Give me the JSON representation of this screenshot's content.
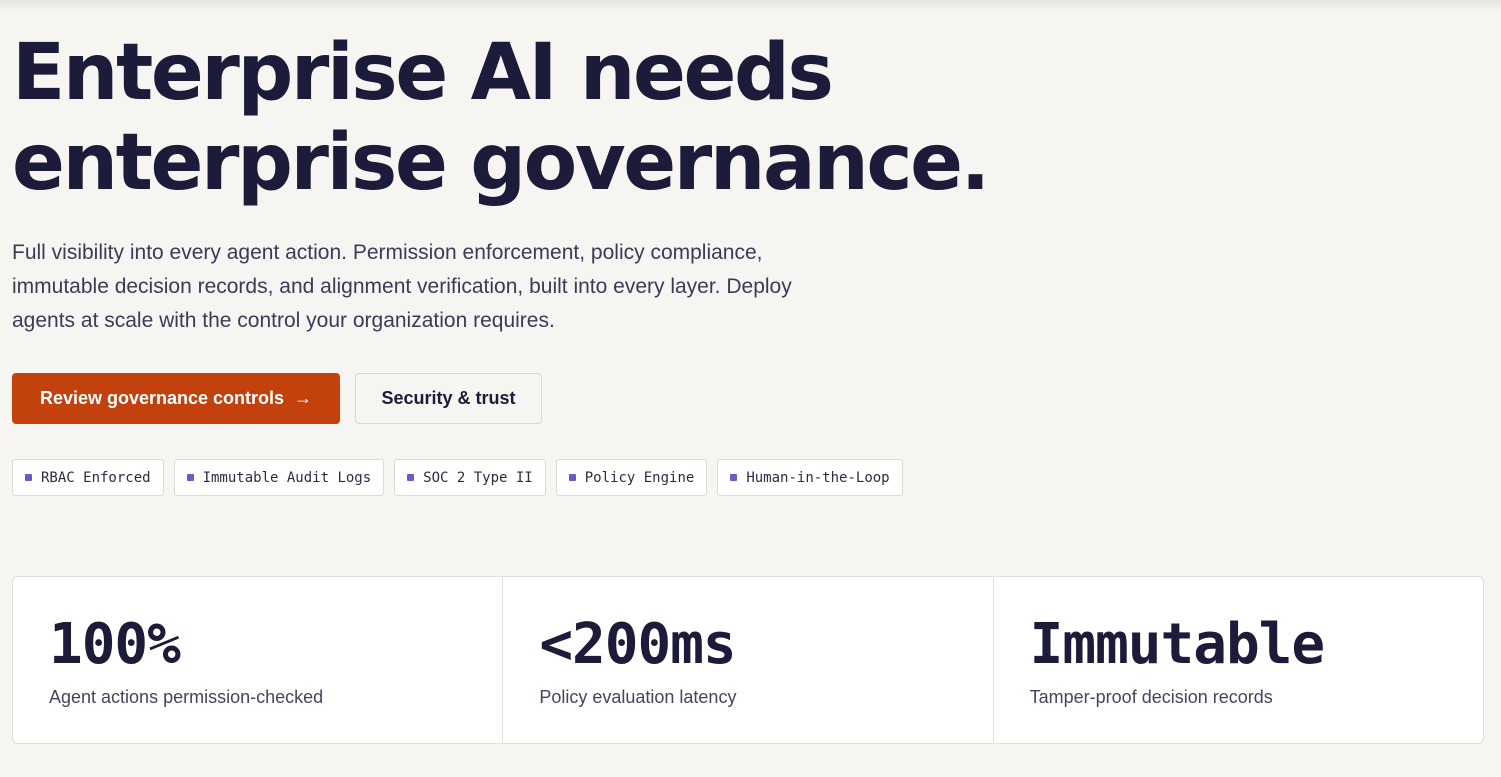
{
  "hero": {
    "headline_line1": "Enterprise AI needs",
    "headline_line2": "enterprise governance.",
    "subtitle": "Full visibility into every agent action. Permission enforcement, policy compliance, immutable decision records, and alignment verification, built into every layer. Deploy agents at scale with the control your organization requires."
  },
  "cta": {
    "primary_label": "Review governance controls",
    "primary_icon": "arrow-right-icon",
    "secondary_label": "Security & trust"
  },
  "badges": [
    {
      "label": "RBAC Enforced"
    },
    {
      "label": "Immutable Audit Logs"
    },
    {
      "label": "SOC 2 Type II"
    },
    {
      "label": "Policy Engine"
    },
    {
      "label": "Human-in-the-Loop"
    }
  ],
  "stats": [
    {
      "value": "100%",
      "label": "Agent actions permission-checked"
    },
    {
      "value": "<200ms",
      "label": "Policy evaluation latency"
    },
    {
      "value": "Immutable",
      "label": "Tamper-proof decision records"
    }
  ],
  "colors": {
    "background": "#f6f5f2",
    "text_primary": "#1c1b3a",
    "accent": "#c2410c",
    "badge_dot": "#6a5acd"
  }
}
